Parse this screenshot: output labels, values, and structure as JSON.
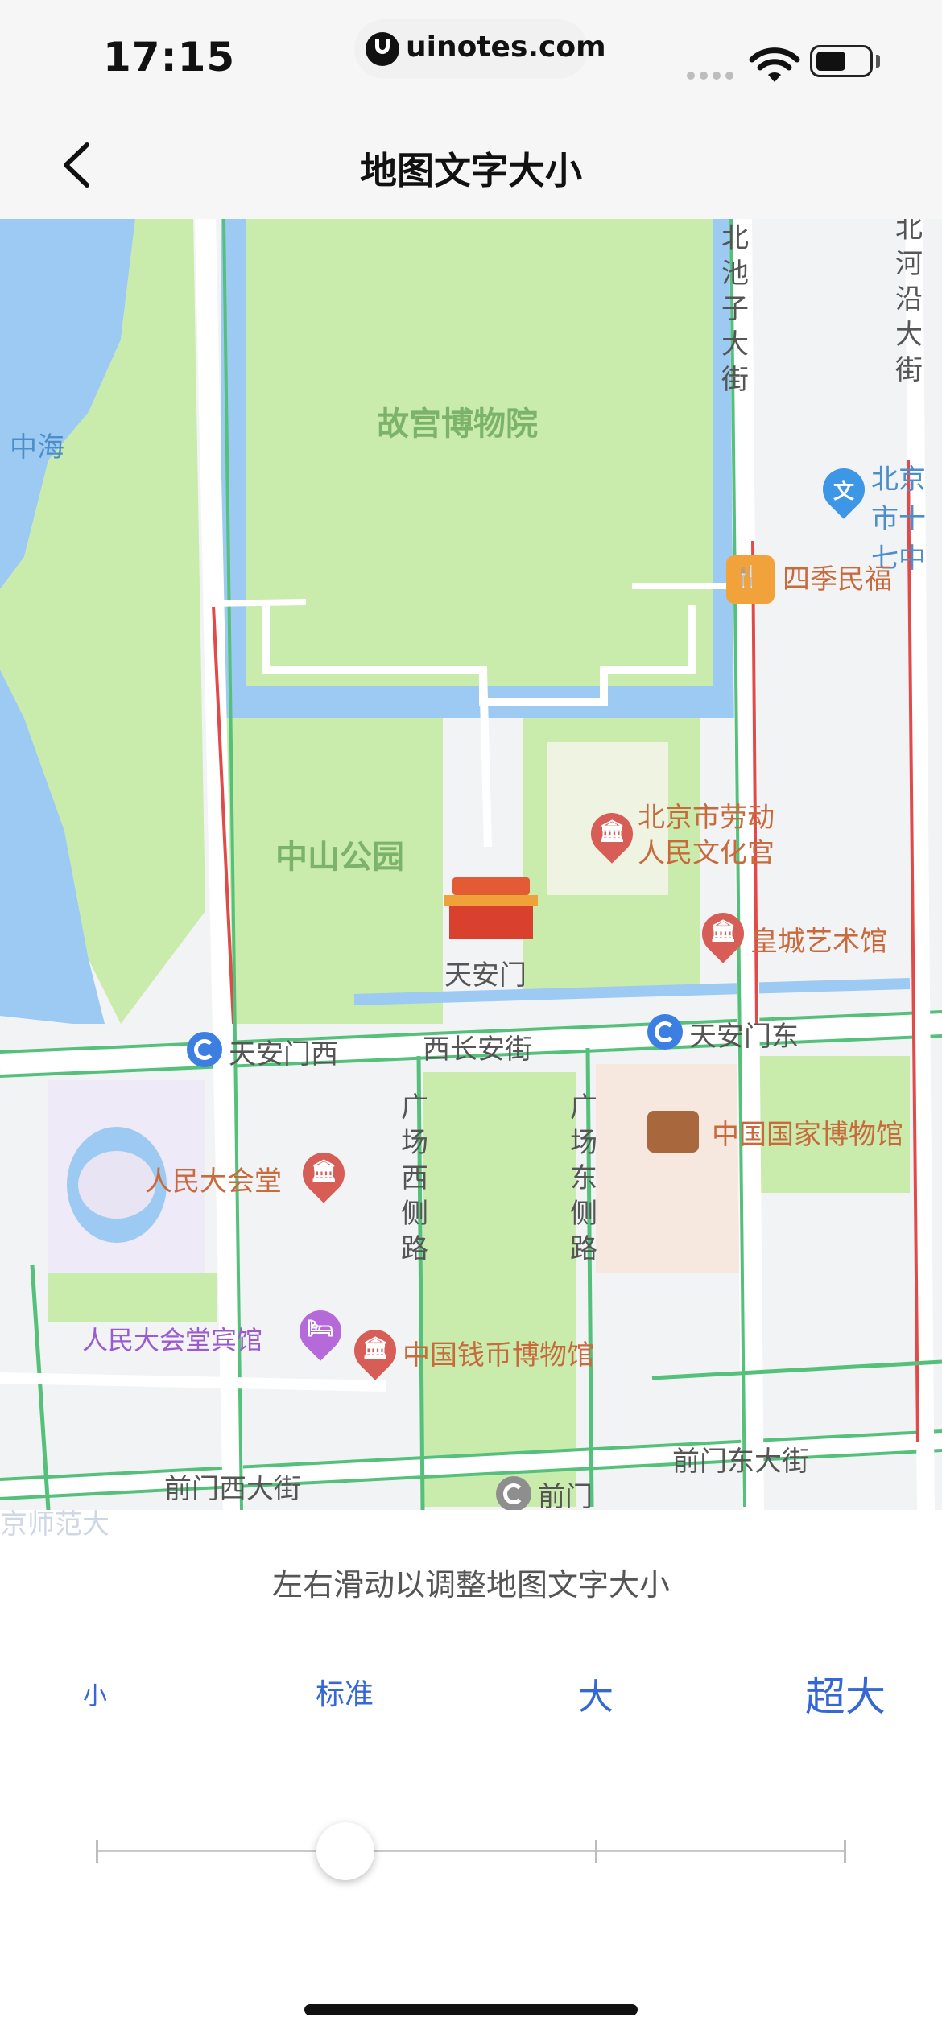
{
  "status_bar": {
    "time": "17:15",
    "url": "uinotes.com",
    "icons": [
      "signal-dots-icon",
      "wifi-icon",
      "battery-icon"
    ]
  },
  "nav": {
    "title": "地图文字大小",
    "back_icon": "chevron-left-icon"
  },
  "map": {
    "water_labels": [
      "中海"
    ],
    "park_labels": [
      "故宫博物院",
      "中山公园"
    ],
    "road_labels": [
      "北池子大街",
      "北河沿大街",
      "西长安街",
      "广场西侧路",
      "广场东侧路",
      "前门西大街",
      "前门东大街"
    ],
    "pois": [
      {
        "name": "北京市十七中",
        "icon": "school-icon"
      },
      {
        "name": "四季民福",
        "icon": "restaurant-icon"
      },
      {
        "name": "北京市劳动人民文化宫",
        "icon": "museum-icon"
      },
      {
        "name": "皇城艺术馆",
        "icon": "museum-icon"
      },
      {
        "name": "天安门",
        "icon": "tiananmen-icon"
      },
      {
        "name": "中国国家博物馆",
        "icon": "museum-building-icon"
      },
      {
        "name": "人民大会堂",
        "icon": "museum-icon"
      },
      {
        "name": "人民大会堂宾馆",
        "icon": "hotel-icon"
      },
      {
        "name": "中国钱币博物馆",
        "icon": "museum-icon"
      }
    ],
    "metro_stations": [
      "天安门西",
      "天安门东",
      "前门"
    ],
    "faded_label": "京师范大"
  },
  "panel": {
    "instruction": "左右滑动以调整地图文字大小",
    "size_options": [
      "小",
      "标准",
      "大",
      "超大"
    ],
    "selected_index": 1
  },
  "colors": {
    "accent": "#3568d4",
    "park": "#c9ebac",
    "water": "#9ccaf2",
    "road": "#ffffff",
    "traffic_green": "#54c07a",
    "traffic_red": "#e24a4a",
    "poi_text": "#c86a3c"
  }
}
